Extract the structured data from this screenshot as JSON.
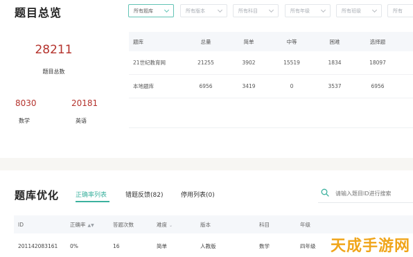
{
  "overview": {
    "title": "题目总览",
    "filters": [
      "所有题库",
      "所有版本",
      "所有科目",
      "所有年级",
      "所有班级",
      "所有"
    ],
    "total_count": "28211",
    "total_label": "题目总数",
    "subjects": [
      {
        "count": "8030",
        "label": "数学"
      },
      {
        "count": "20181",
        "label": "英语"
      }
    ],
    "stats_table": {
      "headers": [
        "题库",
        "总量",
        "简单",
        "中等",
        "困难",
        "选择题"
      ],
      "rows": [
        [
          "21世纪教育网",
          "21255",
          "3902",
          "15519",
          "1834",
          "18097"
        ],
        [
          "本地题库",
          "6956",
          "3419",
          "0",
          "3537",
          "6956"
        ]
      ]
    }
  },
  "optimization": {
    "title": "题库优化",
    "tabs": [
      "正确率列表",
      "错题反馈(82)",
      "停用列表(0)"
    ],
    "active_tab": "正确率列表",
    "search_placeholder": "请输入题目ID进行搜索",
    "table": {
      "headers": [
        "ID",
        "正确率",
        "答题次数",
        "难度",
        "版本",
        "科目",
        "年级"
      ],
      "rows": [
        [
          "201142083161",
          "0%",
          "16",
          "简单",
          "人教版",
          "数学",
          "四年级"
        ]
      ]
    }
  },
  "watermark": "天成手游网",
  "colors": {
    "accent": "#3bb19e",
    "number_red": "#b4322c",
    "watermark": "#f0a51a"
  }
}
